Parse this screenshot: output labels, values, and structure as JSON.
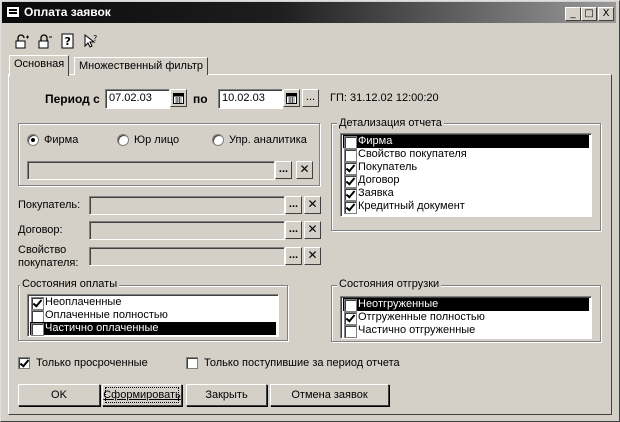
{
  "window": {
    "title": "Оплата заявок",
    "controls": {
      "minimize": "_",
      "maximize": "□",
      "close": "X"
    }
  },
  "toolbar": {
    "icons": [
      "lock-open-icon",
      "lock-closed-icon",
      "help-icon",
      "whats-this-icon"
    ],
    "glyphs": [
      "⛓",
      "⛓",
      "?",
      "⇱"
    ]
  },
  "tabs": [
    "Основная",
    "Множественный фильтр"
  ],
  "period": {
    "label": "Период с",
    "from": "07.02.03",
    "to_label": "по",
    "to": "10.02.03",
    "ellipsis": "...",
    "gp": "ГП:  31.12.02 12:00:20"
  },
  "entity_radio": {
    "options": [
      "Фирма",
      "Юр лицо",
      "Упр. аналитика"
    ],
    "selected": "Фирма"
  },
  "filters": {
    "buyer_label": "Покупатель:",
    "contract_label": "Договор:",
    "property_label_1": "Свойство",
    "property_label_2": "покупателя:",
    "select_glyph": "...",
    "clear_glyph": "✕"
  },
  "detail": {
    "title": "Детализация отчета",
    "items": [
      {
        "label": "Фирма",
        "checked": false,
        "selected": true
      },
      {
        "label": "Свойство покупателя",
        "checked": false,
        "selected": false
      },
      {
        "label": "Покупатель",
        "checked": true,
        "selected": false
      },
      {
        "label": "Договор",
        "checked": true,
        "selected": false
      },
      {
        "label": "Заявка",
        "checked": true,
        "selected": false
      },
      {
        "label": "Кредитный документ",
        "checked": true,
        "selected": false
      }
    ]
  },
  "payment_state": {
    "title": "Состояния оплаты",
    "items": [
      {
        "label": "Неоплаченные",
        "checked": true,
        "selected": false
      },
      {
        "label": "Оплаченные полностью",
        "checked": false,
        "selected": false
      },
      {
        "label": "Частично оплаченные",
        "checked": false,
        "selected": true
      }
    ]
  },
  "shipping_state": {
    "title": "Состояния отгрузки",
    "items": [
      {
        "label": "Неотгруженные",
        "checked": false,
        "selected": true
      },
      {
        "label": "Отгруженные полностью",
        "checked": true,
        "selected": false
      },
      {
        "label": "Частично отгруженные",
        "checked": false,
        "selected": false
      }
    ]
  },
  "options": {
    "overdue_only": {
      "label": "Только просроченные",
      "checked": true
    },
    "received_only": {
      "label": "Только поступившие за период отчета",
      "checked": false
    }
  },
  "buttons": {
    "ok": "OK",
    "build": "Сформировать",
    "close": "Закрыть",
    "cancel_orders": "Отмена заявок"
  }
}
